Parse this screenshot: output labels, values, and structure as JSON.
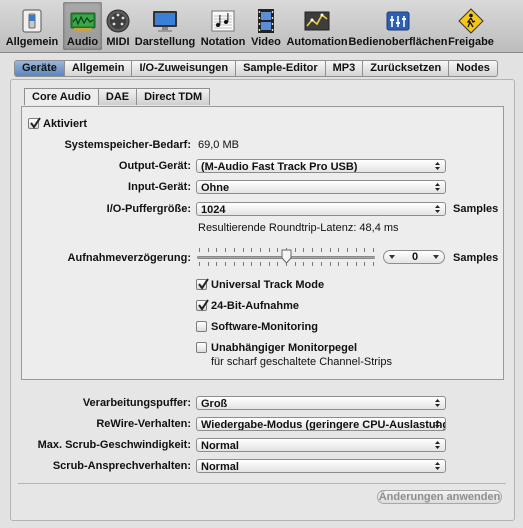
{
  "toolbar": {
    "items": [
      {
        "label": "Allgemein",
        "icon": "switch-icon"
      },
      {
        "label": "Audio",
        "icon": "audio-card-icon"
      },
      {
        "label": "MIDI",
        "icon": "midi-icon"
      },
      {
        "label": "Darstellung",
        "icon": "monitor-icon"
      },
      {
        "label": "Notation",
        "icon": "notes-icon"
      },
      {
        "label": "Video",
        "icon": "film-icon"
      },
      {
        "label": "Automation",
        "icon": "automation-icon"
      },
      {
        "label": "Bedienoberflächen",
        "icon": "control-surface-icon"
      },
      {
        "label": "Freigabe",
        "icon": "share-icon"
      }
    ],
    "selected": "Audio"
  },
  "tabs_top": [
    "Geräte",
    "Allgemein",
    "I/O-Zuweisungen",
    "Sample-Editor",
    "MP3",
    "Zurücksetzen",
    "Nodes"
  ],
  "tabs_inner": [
    "Core Audio",
    "DAE",
    "Direct TDM"
  ],
  "core_audio": {
    "enabled_label": "Aktiviert",
    "enabled": true,
    "memory_label": "Systemspeicher-Bedarf:",
    "memory_value": "69,0 MB",
    "output_label": "Output-Gerät:",
    "output_value": "(M-Audio Fast Track Pro USB)",
    "input_label": "Input-Gerät:",
    "input_value": "Ohne",
    "buffer_label": "I/O-Puffergröße:",
    "buffer_value": "1024",
    "buffer_unit": "Samples",
    "latency_text": "Resultierende Roundtrip-Latenz: 48,4 ms",
    "delay_label": "Aufnahmeverzögerung:",
    "delay_value": "0",
    "delay_unit": "Samples",
    "delay_slider_fraction": 0.5,
    "universal_track_mode": "Universal Track Mode",
    "universal_track_mode_checked": true,
    "bit24": "24-Bit-Aufnahme",
    "bit24_checked": true,
    "software_monitoring": "Software-Monitoring",
    "software_monitoring_checked": false,
    "independent_monitor": "Unabhängiger Monitorpegel",
    "independent_monitor_sub": "für scharf geschaltete Channel-Strips",
    "independent_monitor_checked": false
  },
  "lower": {
    "processing_buffer_label": "Verarbeitungspuffer:",
    "processing_buffer_value": "Groß",
    "rewire_label": "ReWire-Verhalten:",
    "rewire_value": "Wiedergabe-Modus (geringere CPU-Auslastung)",
    "scrub_speed_label": "Max. Scrub-Geschwindigkeit:",
    "scrub_speed_value": "Normal",
    "scrub_response_label": "Scrub-Ansprechverhalten:",
    "scrub_response_value": "Normal"
  },
  "apply_button": "Änderungen anwenden"
}
